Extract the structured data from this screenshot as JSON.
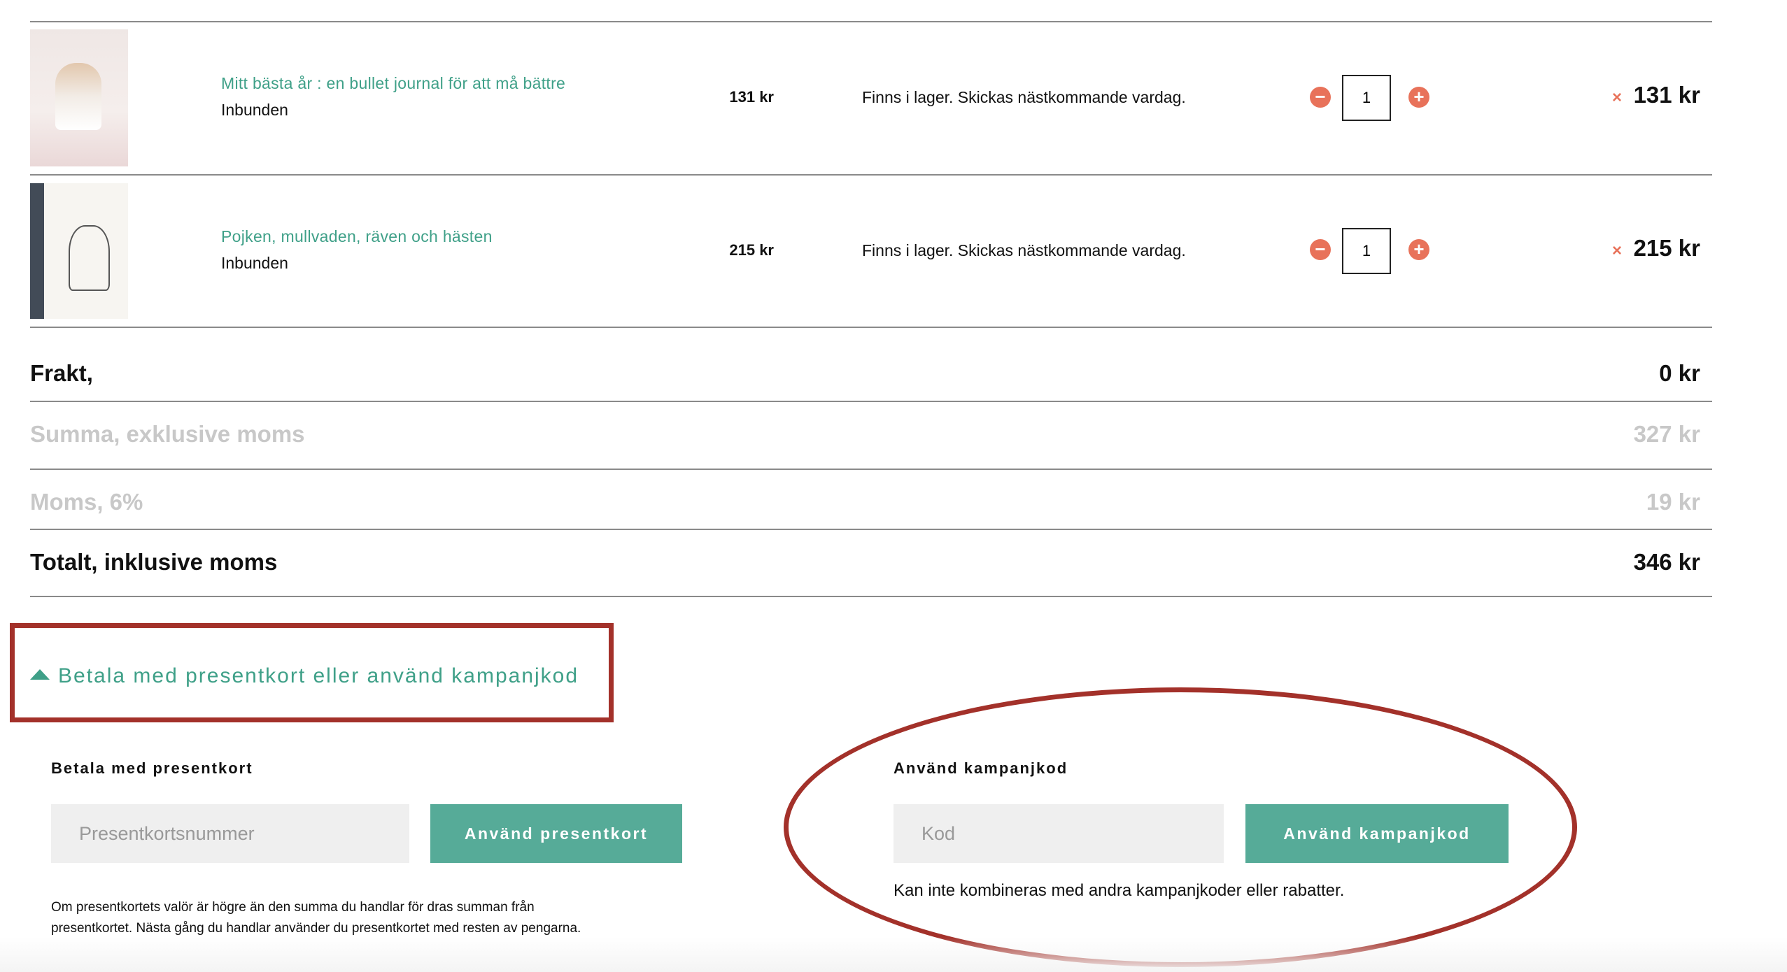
{
  "cart": {
    "items": [
      {
        "title": "Mitt bästa år : en bullet journal för att må bättre",
        "binding": "Inbunden",
        "unit_price": "131 kr",
        "stock": "Finns i lager. Skickas nästkommande vardag.",
        "quantity": "1",
        "decrease": "−",
        "increase": "+",
        "remove": "×",
        "line_total": "131 kr"
      },
      {
        "title": "Pojken, mullvaden, räven och hästen",
        "binding": "Inbunden",
        "unit_price": "215 kr",
        "stock": "Finns i lager. Skickas nästkommande vardag.",
        "quantity": "1",
        "decrease": "−",
        "increase": "+",
        "remove": "×",
        "line_total": "215 kr"
      }
    ]
  },
  "summary": {
    "shipping": {
      "label": "Frakt,",
      "value": "0 kr"
    },
    "subtotal": {
      "label": "Summa, exklusive moms",
      "value": "327 kr"
    },
    "vat": {
      "label": "Moms, 6%",
      "value": "19 kr"
    },
    "total": {
      "label": "Totalt, inklusive moms",
      "value": "346 kr"
    }
  },
  "discount": {
    "toggle_label": "Betala med presentkort eller använd kampanjkod",
    "giftcard": {
      "heading": "Betala med presentkort",
      "placeholder": "Presentkortsnummer",
      "button": "Använd presentkort",
      "info": "Om presentkortets valör är högre än den summa du handlar för dras summan från presentkortet. Nästa gång du handlar använder du presentkortet med resten av pengarna."
    },
    "campaign": {
      "heading": "Använd kampanjkod",
      "placeholder": "Kod",
      "button": "Använd kampanjkod",
      "note": "Kan inte kombineras med andra kampanjkoder eller rabatter."
    }
  },
  "colors": {
    "accent_green": "#3fa088",
    "button_green": "#56ab98",
    "quantity_buttons": "#e8725a",
    "annotation_red": "#a3312a"
  }
}
